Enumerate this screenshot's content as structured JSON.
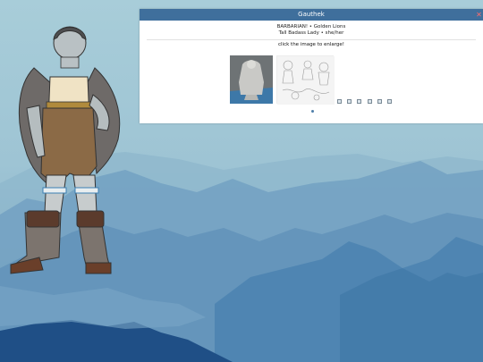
{
  "card": {
    "title": "Gauthek",
    "close_icon": "close-icon",
    "line1": "BARBARIAN! • Golden Lions",
    "line2": "Tall Badass Lady • she/her",
    "click_note": "click the image to enlarge!"
  },
  "gallery": {
    "thumbnails": [
      {
        "name": "miniature-figure-photo"
      },
      {
        "name": "character-sketch-sheet"
      }
    ],
    "small_icons": [
      "image-icon",
      "image-icon",
      "image-icon",
      "image-icon",
      "image-icon",
      "image-icon"
    ]
  },
  "colors": {
    "header_bg": "#3f6f9c",
    "close": "#ff6b6b",
    "sky": "#9cc1d2",
    "mountain_dark": "#1f4f86"
  }
}
